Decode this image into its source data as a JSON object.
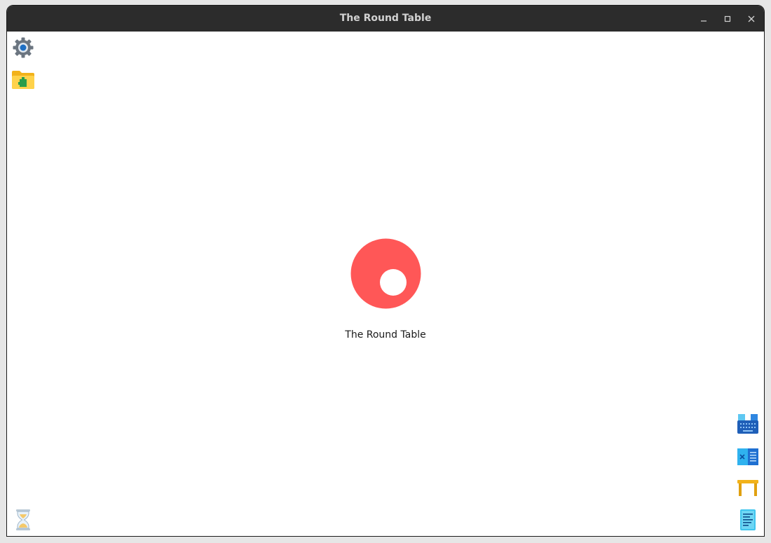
{
  "window": {
    "title": "The Round Table",
    "controls": {
      "minimize": "minimize-icon",
      "maximize": "maximize-icon",
      "close": "close-icon"
    }
  },
  "app": {
    "name": "The Round Table",
    "logo_color": "#ff5757"
  },
  "desktop_icons": {
    "left": [
      "settings-gear-icon",
      "folder-extension-icon",
      "hourglass-icon"
    ],
    "right": [
      "keyboard-icon",
      "vscode-icon",
      "table-icon",
      "text-document-icon"
    ]
  },
  "colors": {
    "titlebar": "#2c2c2c",
    "background": "#ffffff",
    "accent": "#ff5757"
  }
}
